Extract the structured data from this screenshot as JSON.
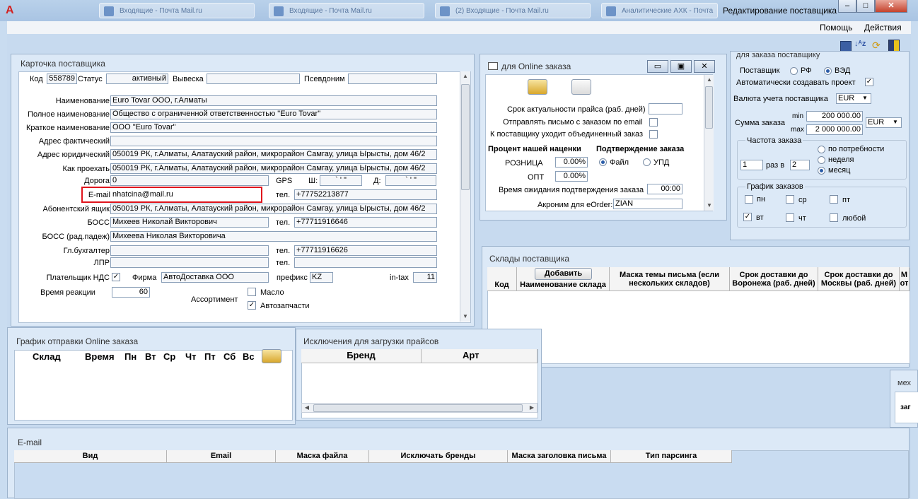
{
  "window": {
    "title": "Редактирование поставщика",
    "bg_tabs": [
      "Входящие - Почта Mail.ru",
      "Входящие - Почта Mail.ru",
      "(2) Входящие - Почта Mail.ru",
      "Аналитические АХК - Почта"
    ]
  },
  "menu": {
    "help": "Помощь",
    "actions": "Действия"
  },
  "card": {
    "title": "Карточка поставщика",
    "code_label": "Код",
    "code": "558789",
    "status_label": "Статус",
    "status": "активный",
    "sign_label": "Вывеска",
    "sign": "",
    "pseudo_label": "Псевдоним",
    "pseudo": "",
    "name_label": "Наименование",
    "name": "Euro Tovar ООО, г.Алматы",
    "fullname_label": "Полное наименование",
    "fullname": "Общество с ограниченной ответственностью \"Euro Tovar\"",
    "short_label": "Краткое наименование",
    "short": "ООО \"Euro Tovar\"",
    "addr_fact_label": "Адрес фактический",
    "addr_fact": "",
    "addr_jur_label": "Адрес юридический",
    "addr_jur": "050019 РК, г.Алматы, Алатауский район, микрорайон Самгау, улица Ырысты, дом 46/2",
    "route_label": "Как проехать",
    "route": "050019 РК, г.Алматы, Алатауский район, микрорайон Самгау, улица Ырысты, дом 46/2",
    "road_label": "Дорога",
    "road": "0",
    "gps_label": "GPS",
    "lat_label": "Ш:",
    "lat": "` '  \"",
    "lon_label": "Д:",
    "lon": "` '  \"",
    "email_label": "E-mail",
    "email": "nhatcina@mail.ru",
    "tel_label": "тел.",
    "tel": "+77752213877",
    "pobox_label": "Абонентский ящик",
    "pobox": "050019 РК, г.Алматы, Алатауский район, микрорайон Самгау, улица Ырысты, дом 46/2",
    "boss_label": "БОСС",
    "boss": "Михеев Николай Викторович",
    "boss_tel": "+77711916646",
    "boss_gen_label": "БОСС (рад.падеж)",
    "boss_gen": "Михеева Николая Викторовича",
    "accountant_label": "Гл.бухгалтер",
    "accountant": "",
    "accountant_tel": "+77711916626",
    "lpr_label": "ЛПР",
    "lpr": "",
    "lpr_tel": "",
    "vat_label": "Плательщик НДС",
    "vat_checked": "✓",
    "firm_label": "Фирма",
    "firm": "АвтоДоставка ООО",
    "prefix_label": "префикс",
    "prefix": "KZ",
    "intax_label": "in-tax",
    "intax": "11",
    "reaction_label": "Время реакции",
    "reaction": "60",
    "assortment_label": "Ассортимент",
    "oil_label": "Масло",
    "oil_checked": "",
    "parts_label": "Автозапчасти",
    "parts_checked": "✓"
  },
  "online": {
    "title": "для Online заказа",
    "price_days_label": "Срок актуальности прайса (раб. дней)",
    "price_days": "",
    "send_email_label": "Отправлять письмо с заказом по email",
    "combined_label": "К поставщику уходит объединенный заказ",
    "markup_title": "Процент нашей наценки",
    "retail_label": "РОЗНИЦА",
    "retail": "0.00%",
    "wholesale_label": "ОПТ",
    "wholesale": "0.00%",
    "confirm_title": "Подтверждение заказа",
    "file_label": "Файл",
    "upd_label": "УПД",
    "wait_label": "Время ожидания подтверждения заказа",
    "wait": "00:00",
    "acronym_label": "Акроним для eOrder:",
    "acronym": "ZIAN"
  },
  "order": {
    "title": "для заказа поставщику",
    "supplier_label": "Поставщик",
    "rf_label": "РФ",
    "ved_label": "ВЭД",
    "auto_label": "Автоматически создавать проект",
    "auto_checked": "✓",
    "currency_label": "Валюта учета поставщика",
    "currency": "EUR",
    "sum_label": "Сумма заказа",
    "min_label": "min",
    "min": "200 000.00",
    "max_label": "max",
    "max": "2 000 000.00",
    "sum_currency": "EUR",
    "freq_title": "Частота заказа",
    "freq_count": "1",
    "freq_in_label": "раз в",
    "freq_period": "2",
    "need_label": "по потребности",
    "week_label": "неделя",
    "month_label": "месяц",
    "schedule_title": "График заказов",
    "mon": "пн",
    "wed": "ср",
    "fri": "пт",
    "tue": "вт",
    "thu": "чт",
    "any": "любой",
    "tue_checked": "✓"
  },
  "warehouses": {
    "title": "Склады поставщика",
    "add_button": "Добавить",
    "columns": [
      "Код",
      "Наименование склада",
      "Маска  темы письма (если нескольких складов)",
      "Срок доставки до Воронежа (раб. дней)",
      "Срок доставки до Москвы (раб. дней)",
      "М от"
    ]
  },
  "schedule": {
    "title": "График отправки Online заказа",
    "columns": [
      "Склад",
      "Время",
      "Пн",
      "Вт",
      "Ср",
      "Чт",
      "Пт",
      "Сб",
      "Вс"
    ]
  },
  "exclusions": {
    "title": "Исключения для загрузки прайсов",
    "columns": [
      "Бренд",
      "Арт"
    ]
  },
  "mech": {
    "title": "мех",
    "item": "заг"
  },
  "email_table": {
    "title": "E-mail",
    "columns": [
      "Вид",
      "Email",
      "Маска файла",
      "Исключать бренды",
      "Маска заголовка письма",
      "Тип парсинга"
    ]
  }
}
